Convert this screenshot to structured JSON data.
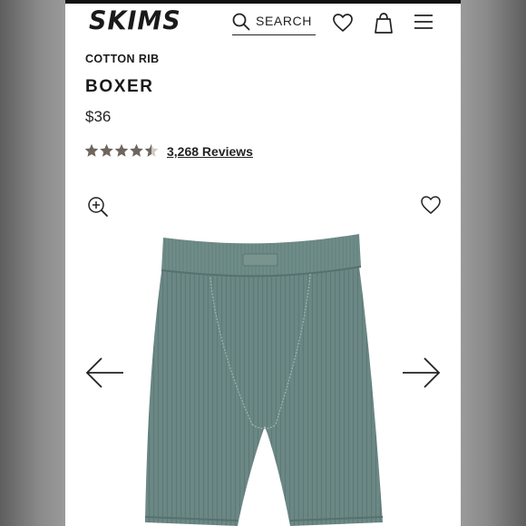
{
  "header": {
    "logo": "SKIMS",
    "search_label": "SEARCH",
    "icons": [
      "search-icon",
      "heart-icon",
      "shopping-bag-icon",
      "menu-icon"
    ]
  },
  "product": {
    "collection": "COTTON RIB",
    "name": "BOXER",
    "price": "$36",
    "rating": 4.5,
    "rating_max": 5,
    "reviews_label": "3,268 Reviews"
  },
  "gallery": {
    "icons": [
      "zoom-in-icon",
      "wishlist-heart-icon",
      "arrow-left-icon",
      "arrow-right-icon"
    ],
    "product_image": "sage green ribbed boxer shorts"
  },
  "colors": {
    "text": "#1a1a1a",
    "star": "#6e655d",
    "product": "#6b8885"
  }
}
